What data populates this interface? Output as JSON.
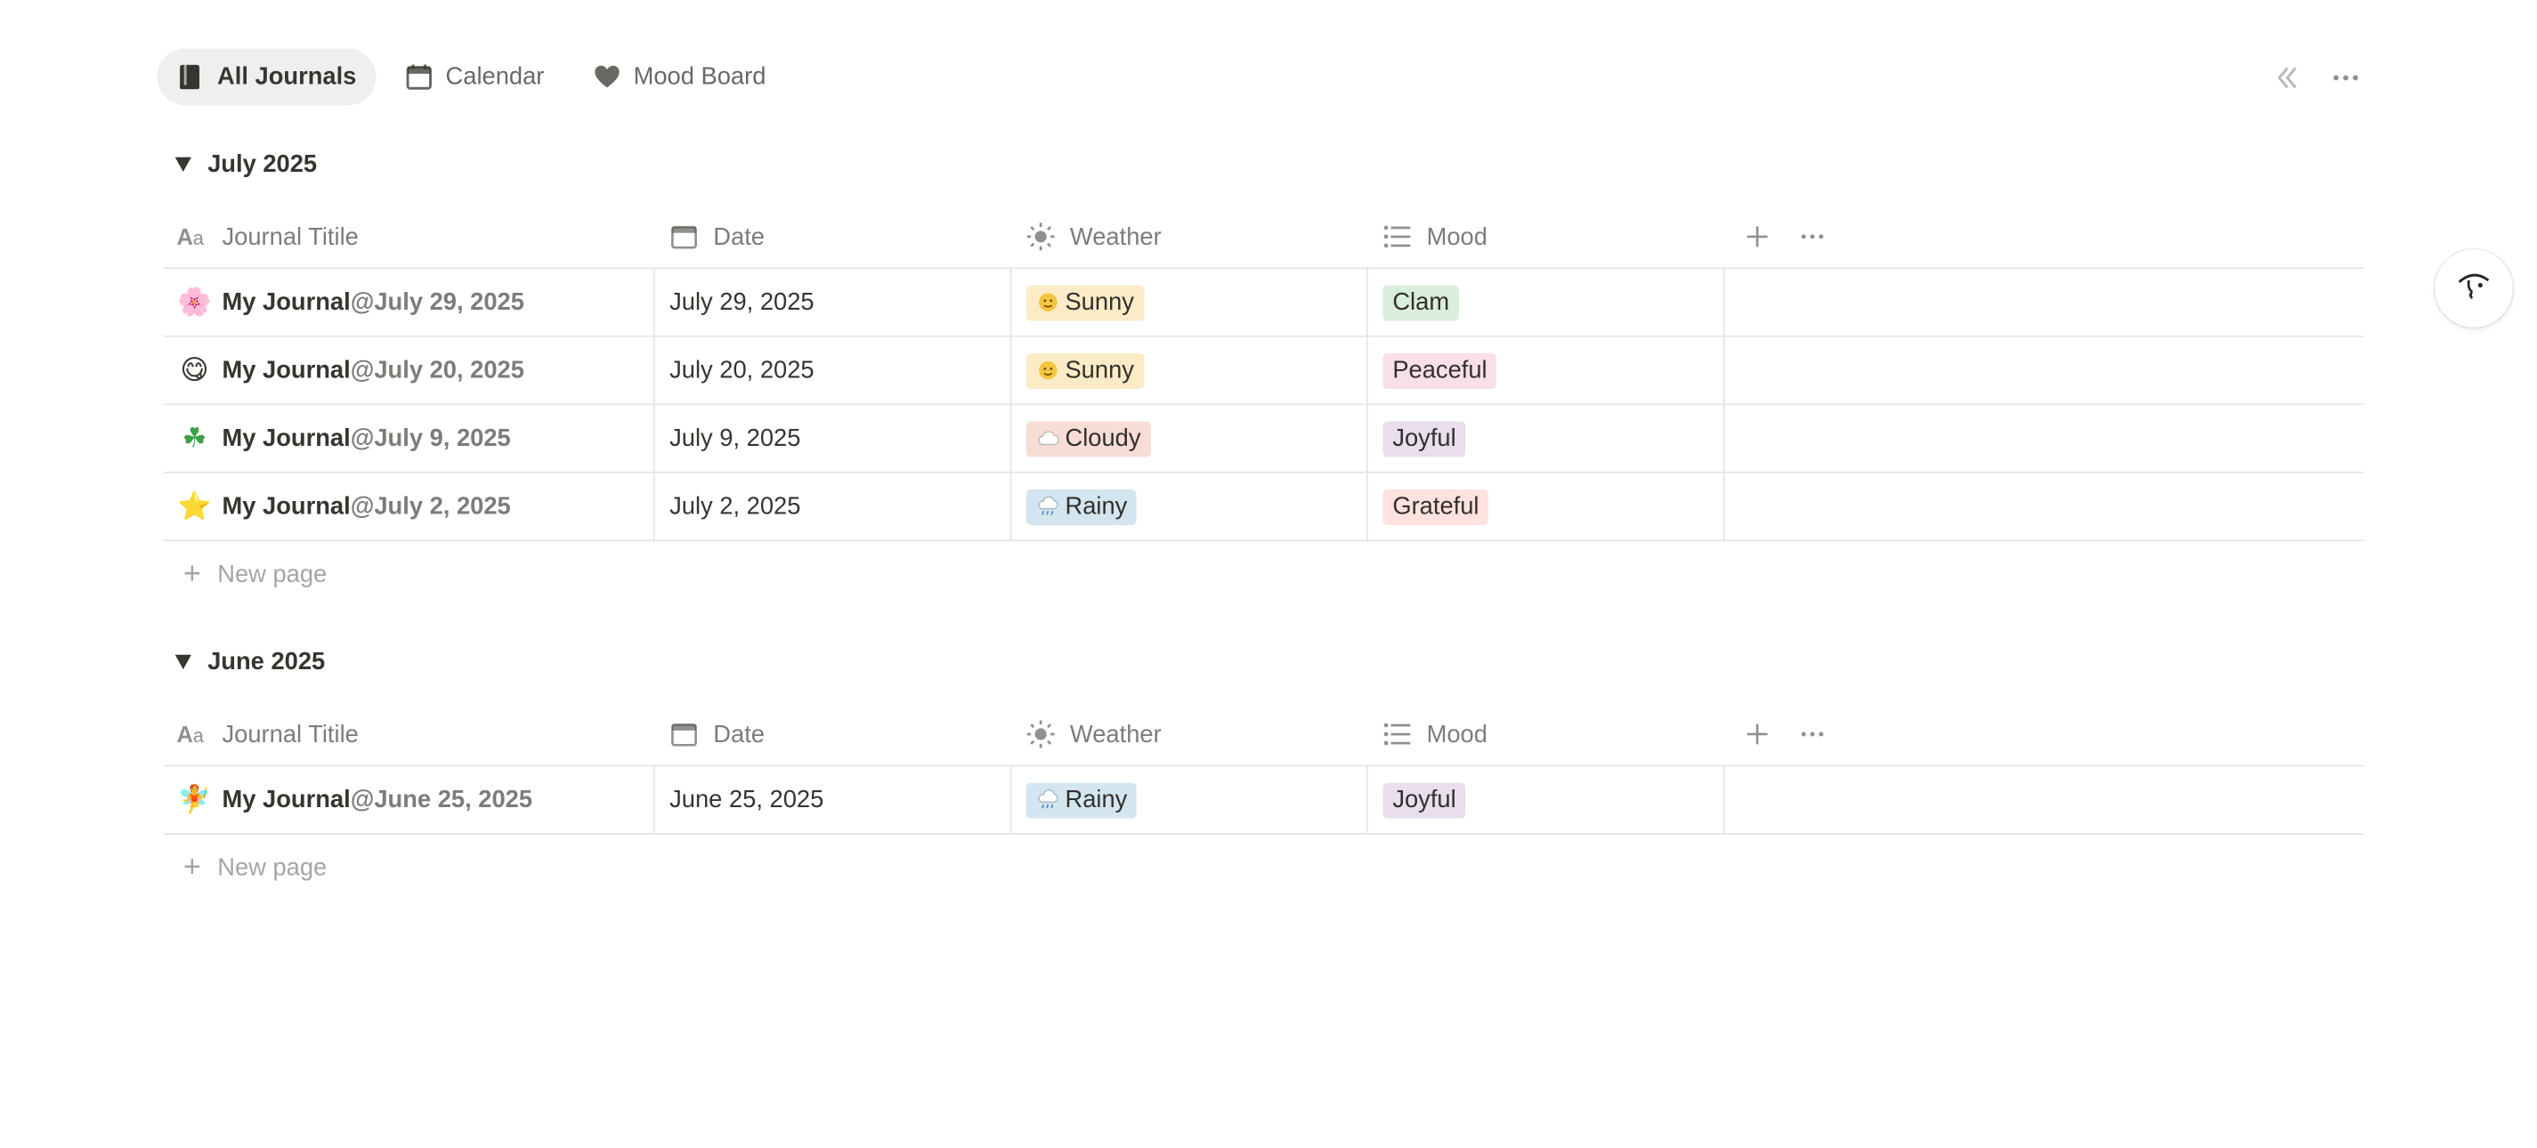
{
  "tabs": [
    {
      "label": "All Journals",
      "icon": "journals-icon",
      "active": true
    },
    {
      "label": "Calendar",
      "icon": "calendar-icon",
      "active": false
    },
    {
      "label": "Mood Board",
      "icon": "heart-icon",
      "active": false
    }
  ],
  "columns": {
    "title": "Journal Titile",
    "date": "Date",
    "weather": "Weather",
    "mood": "Mood"
  },
  "new_page_label": "New page",
  "groups": [
    {
      "label": "July 2025",
      "rows": [
        {
          "emoji": "🌸",
          "title": "My Journal",
          "at": "@",
          "title_date": "July 29, 2025",
          "date": "July 29, 2025",
          "weather": "Sunny",
          "weather_icon": "sun-face-icon",
          "mood": "Clam"
        },
        {
          "emoji": "😋",
          "title": "My Journal",
          "at": "@",
          "title_date": "July 20, 2025",
          "date": "July 20, 2025",
          "weather": "Sunny",
          "weather_icon": "sun-face-icon",
          "mood": "Peaceful"
        },
        {
          "emoji": "☘",
          "title": "My Journal",
          "at": "@",
          "title_date": "July 9, 2025",
          "date": "July 9, 2025",
          "weather": "Cloudy",
          "weather_icon": "cloud-icon",
          "mood": "Joyful"
        },
        {
          "emoji": "⭐",
          "title": "My Journal",
          "at": "@",
          "title_date": "July 2, 2025",
          "date": "July 2, 2025",
          "weather": "Rainy",
          "weather_icon": "rain-cloud-icon",
          "mood": "Grateful"
        }
      ]
    },
    {
      "label": "June 2025",
      "rows": [
        {
          "emoji": "🧚",
          "title": "My Journal",
          "at": "@",
          "title_date": "June 25, 2025",
          "date": "June 25, 2025",
          "weather": "Rainy",
          "weather_icon": "rain-cloud-icon",
          "mood": "Joyful"
        }
      ]
    }
  ],
  "colors": {
    "sunny_bg": "#fbecc7",
    "cloudy_bg": "#f7ddd6",
    "rainy_bg": "#d3e5ef",
    "mood_clam": "#dbeddb",
    "mood_peaceful": "#f9dfe9",
    "mood_joyful": "#e8deee",
    "mood_grateful": "#ffe2dd"
  }
}
